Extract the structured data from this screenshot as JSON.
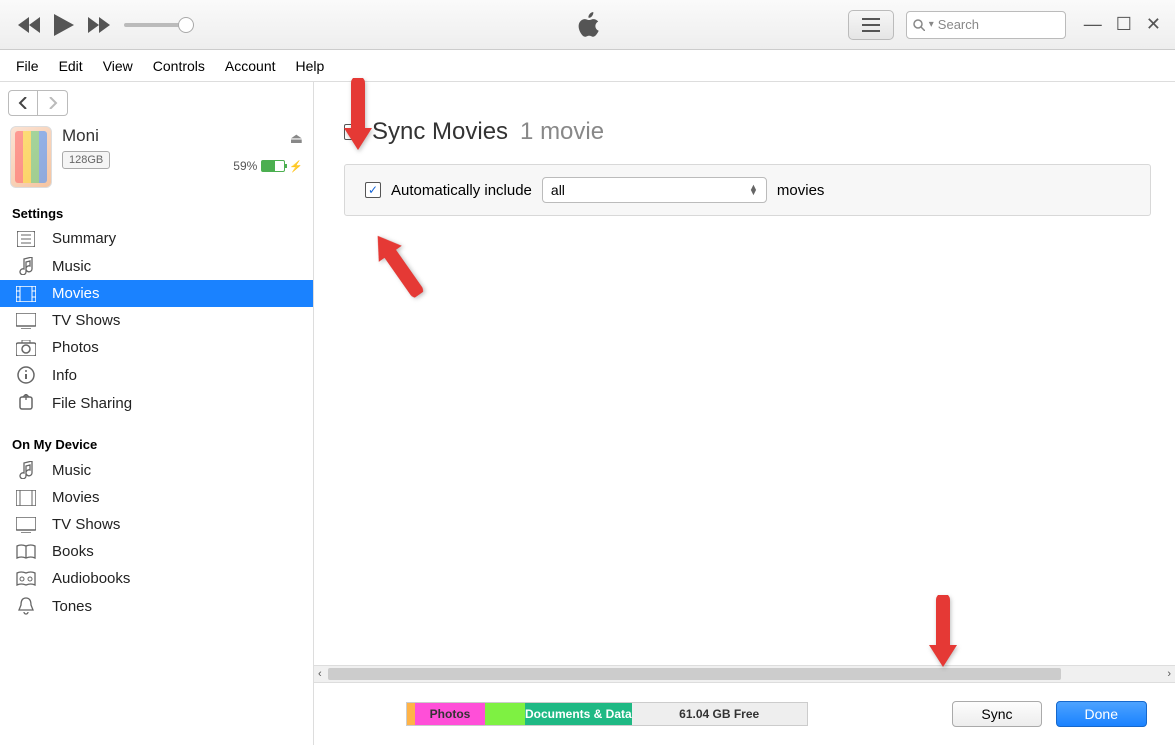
{
  "menu": [
    "File",
    "Edit",
    "View",
    "Controls",
    "Account",
    "Help"
  ],
  "search": {
    "placeholder": "Search"
  },
  "device": {
    "name": "Moni",
    "storage": "128GB",
    "battery_pct": "59%"
  },
  "sidebar": {
    "settings_title": "Settings",
    "settings": [
      {
        "key": "summary",
        "label": "Summary"
      },
      {
        "key": "music",
        "label": "Music"
      },
      {
        "key": "movies",
        "label": "Movies"
      },
      {
        "key": "tvshows",
        "label": "TV Shows"
      },
      {
        "key": "photos",
        "label": "Photos"
      },
      {
        "key": "info",
        "label": "Info"
      },
      {
        "key": "filesharing",
        "label": "File Sharing"
      }
    ],
    "ondevice_title": "On My Device",
    "ondevice": [
      {
        "key": "music",
        "label": "Music"
      },
      {
        "key": "movies",
        "label": "Movies"
      },
      {
        "key": "tvshows",
        "label": "TV Shows"
      },
      {
        "key": "books",
        "label": "Books"
      },
      {
        "key": "audiobooks",
        "label": "Audiobooks"
      },
      {
        "key": "tones",
        "label": "Tones"
      }
    ]
  },
  "main": {
    "sync_label": "Sync Movies",
    "count_label": "1 movie",
    "auto_label": "Automatically include",
    "dropdown_value": "all",
    "suffix_label": "movies"
  },
  "storage_bar": {
    "photos": "Photos",
    "docs": "Documents & Data",
    "free": "61.04 GB Free"
  },
  "buttons": {
    "sync": "Sync",
    "done": "Done"
  }
}
